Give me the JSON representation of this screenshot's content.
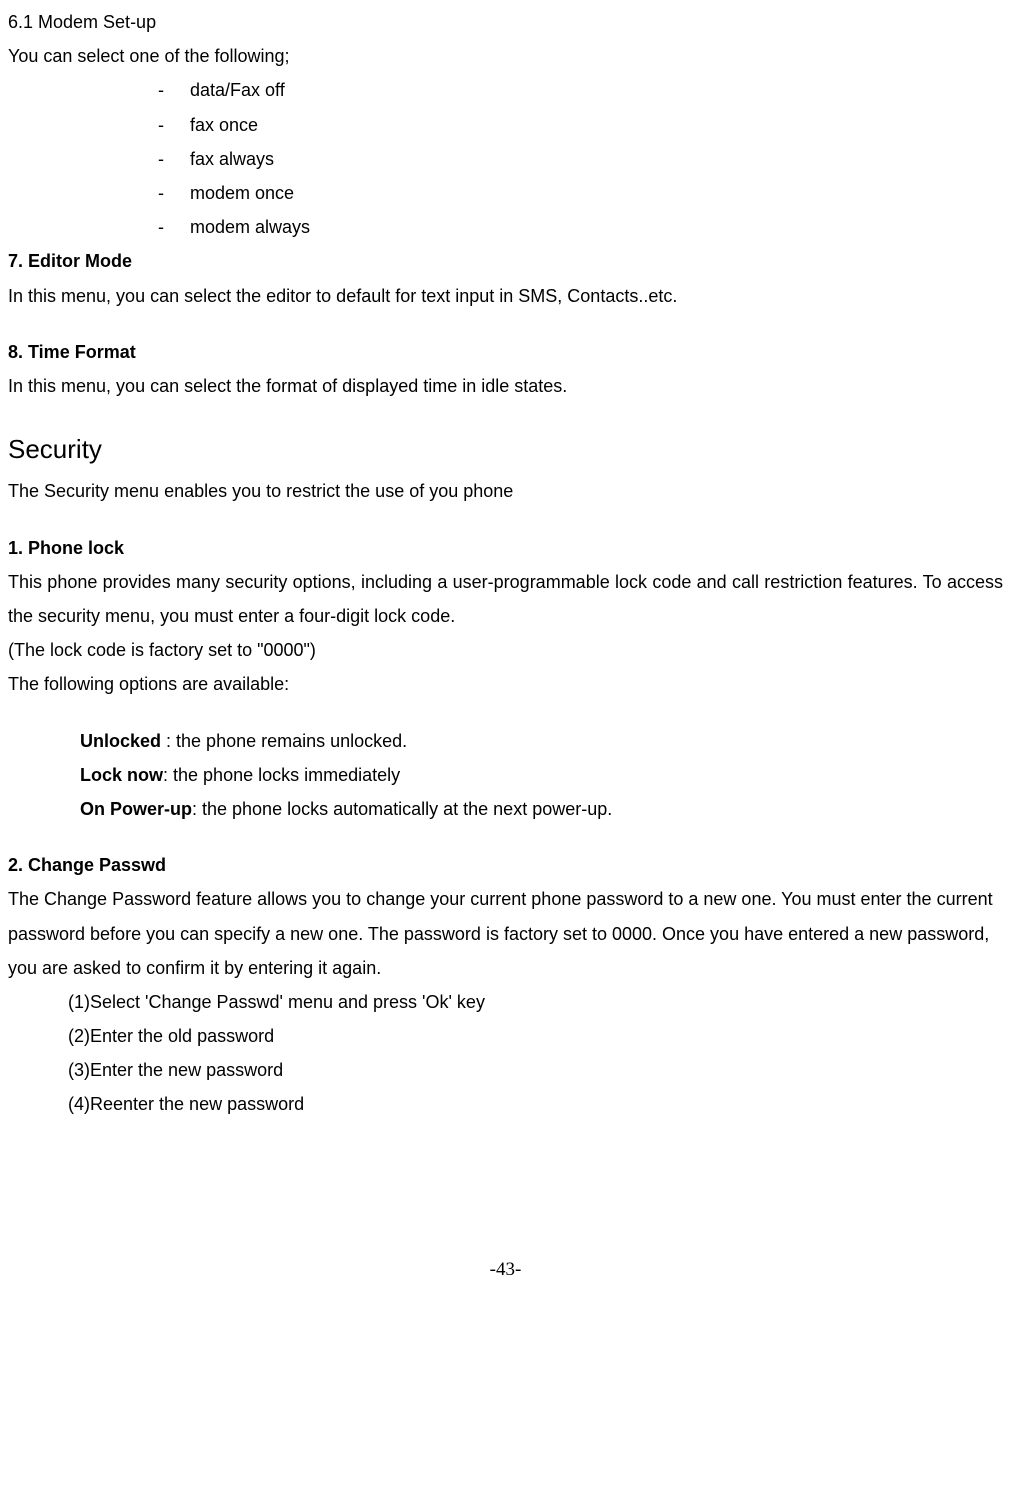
{
  "s61": {
    "title": "6.1 Modem Set-up",
    "intro": "You can select one of the following;",
    "items": [
      "data/Fax off",
      "fax once",
      "fax always",
      "modem once",
      "modem always"
    ]
  },
  "s7": {
    "title": "7. Editor Mode",
    "body": "In this menu, you can select the editor to default for text input in SMS, Contacts..etc."
  },
  "s8": {
    "title": "8. Time Format",
    "body": "In this menu, you can select the format of displayed time in idle states."
  },
  "security": {
    "title": "Security",
    "intro": "The Security menu enables you to restrict the use of you phone"
  },
  "phonelock": {
    "title": "1. Phone lock",
    "p1": "This phone provides many security options, including a user-programmable lock code and call restriction features. To access the security menu, you must enter a four-digit lock code.",
    "p2": "(The lock code is factory set to \"0000\")",
    "p3": "The following options are available:",
    "options": [
      {
        "label": "Unlocked ",
        "desc": ": the phone remains unlocked."
      },
      {
        "label": "Lock now",
        "desc": ": the phone locks immediately"
      },
      {
        "label": "On Power-up",
        "desc": ": the phone locks automatically at the next power-up."
      }
    ]
  },
  "changepw": {
    "title": "2. Change Passwd",
    "p1": "The Change Password feature allows you to change your current phone password to a new one. You must enter the current password before you can specify a new one. The password is factory set to 0000. Once you have entered a new password, you are asked to confirm it by entering it again.",
    "steps": [
      {
        "num": "(1) ",
        "text": "Select 'Change Passwd' menu and press 'Ok' key"
      },
      {
        "num": "(2) ",
        "text": "Enter the old password"
      },
      {
        "num": "(3) ",
        "text": "Enter the new password"
      },
      {
        "num": "(4) ",
        "text": "Reenter the new password"
      }
    ]
  },
  "pagenum": "-43-"
}
